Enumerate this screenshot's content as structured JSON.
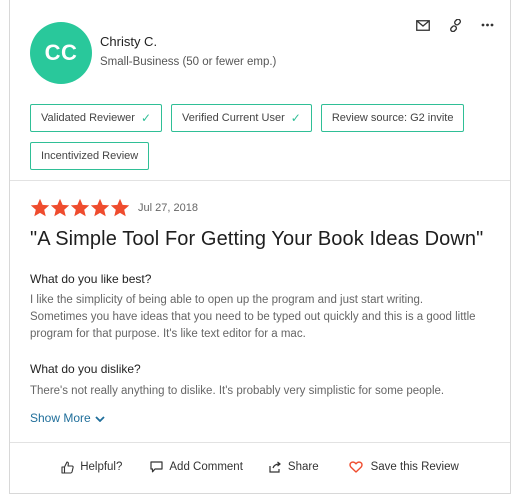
{
  "reviewer": {
    "initials": "CC",
    "name": "Christy C.",
    "company_size": "Small-Business (50 or fewer emp.)",
    "avatar_color": "#29c89b"
  },
  "top_actions": [
    {
      "icon": "envelope-icon"
    },
    {
      "icon": "link-icon"
    },
    {
      "icon": "more-icon"
    }
  ],
  "badges": [
    {
      "label": "Validated Reviewer",
      "checked": true
    },
    {
      "label": "Verified Current User",
      "checked": true
    },
    {
      "label": "Review source: G2 invite",
      "checked": false
    },
    {
      "label": "Incentivized Review",
      "checked": false
    }
  ],
  "review": {
    "rating": 5,
    "rating_max": 5,
    "star_color": "#ef4c2e",
    "date": "Jul 27, 2018",
    "title": "\"A Simple Tool For Getting Your Book Ideas Down\"",
    "q1": "What do you like best?",
    "a1_lines": [
      "I like the simplicity of being able to open up the program and just start writing.",
      "Sometimes you have ideas that you need to be typed out quickly and this is a good little",
      "program for that purpose. It's like text editor for a mac."
    ],
    "q2": "What do you dislike?",
    "a2": "There's not really anything to dislike. It's probably very simplistic for some people.",
    "show_more": "Show More"
  },
  "footer": {
    "helpful": "Helpful?",
    "add_comment": "Add Comment",
    "share": "Share",
    "save": "Save this Review",
    "save_icon_color": "#ef4c2e"
  },
  "colors": {
    "accent": "#2fbf96",
    "link": "#1f6e9a"
  }
}
